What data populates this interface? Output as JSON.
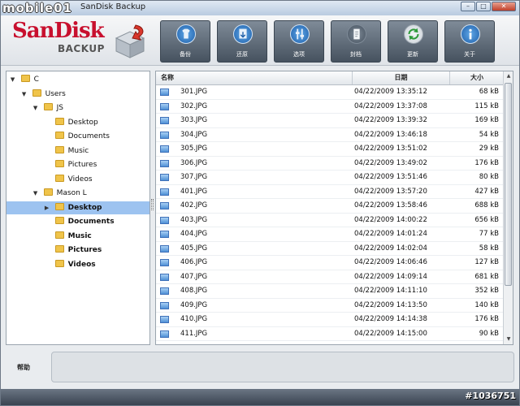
{
  "window": {
    "title": "SanDisk Backup",
    "watermark_logo": "mobile01",
    "watermark_id": "#1036751"
  },
  "brand": {
    "name": "SanDisk",
    "sub": "BACKUP",
    "color": "#c8102e"
  },
  "toolbar": [
    {
      "label": "备份",
      "icon": "shirt-icon"
    },
    {
      "label": "还原",
      "icon": "restore-icon"
    },
    {
      "label": "选项",
      "icon": "options-icon"
    },
    {
      "label": "封档",
      "icon": "archive-icon"
    },
    {
      "label": "更新",
      "icon": "refresh-icon"
    },
    {
      "label": "关于",
      "icon": "info-icon"
    }
  ],
  "tree": [
    {
      "label": "C",
      "toggle": "▼",
      "bold": false,
      "selected": false
    },
    {
      "label": "Users",
      "toggle": "▼",
      "bold": false,
      "selected": false
    },
    {
      "label": "JS",
      "toggle": "▼",
      "bold": false,
      "selected": false
    },
    {
      "label": "Desktop",
      "toggle": "",
      "bold": false,
      "selected": false
    },
    {
      "label": "Documents",
      "toggle": "",
      "bold": false,
      "selected": false
    },
    {
      "label": "Music",
      "toggle": "",
      "bold": false,
      "selected": false
    },
    {
      "label": "Pictures",
      "toggle": "",
      "bold": false,
      "selected": false
    },
    {
      "label": "Videos",
      "toggle": "",
      "bold": false,
      "selected": false
    },
    {
      "label": "Mason L",
      "toggle": "▼",
      "bold": false,
      "selected": false
    },
    {
      "label": "Desktop",
      "toggle": "▶",
      "bold": true,
      "selected": true
    },
    {
      "label": "Documents",
      "toggle": "",
      "bold": true,
      "selected": false
    },
    {
      "label": "Music",
      "toggle": "",
      "bold": true,
      "selected": false
    },
    {
      "label": "Pictures",
      "toggle": "",
      "bold": true,
      "selected": false
    },
    {
      "label": "Videos",
      "toggle": "",
      "bold": true,
      "selected": false
    }
  ],
  "grid": {
    "headers": {
      "name": "名称",
      "date": "日期",
      "size": "大小"
    },
    "rows": [
      {
        "name": "301.JPG",
        "date": "04/22/2009 13:35:12",
        "size": "68 kB"
      },
      {
        "name": "302.JPG",
        "date": "04/22/2009 13:37:08",
        "size": "115 kB"
      },
      {
        "name": "303.JPG",
        "date": "04/22/2009 13:39:32",
        "size": "169 kB"
      },
      {
        "name": "304.JPG",
        "date": "04/22/2009 13:46:18",
        "size": "54 kB"
      },
      {
        "name": "305.JPG",
        "date": "04/22/2009 13:51:02",
        "size": "29 kB"
      },
      {
        "name": "306.JPG",
        "date": "04/22/2009 13:49:02",
        "size": "176 kB"
      },
      {
        "name": "307.JPG",
        "date": "04/22/2009 13:51:46",
        "size": "80 kB"
      },
      {
        "name": "401.JPG",
        "date": "04/22/2009 13:57:20",
        "size": "427 kB"
      },
      {
        "name": "402.JPG",
        "date": "04/22/2009 13:58:46",
        "size": "688 kB"
      },
      {
        "name": "403.JPG",
        "date": "04/22/2009 14:00:22",
        "size": "656 kB"
      },
      {
        "name": "404.JPG",
        "date": "04/22/2009 14:01:24",
        "size": "77 kB"
      },
      {
        "name": "405.JPG",
        "date": "04/22/2009 14:02:04",
        "size": "58 kB"
      },
      {
        "name": "406.JPG",
        "date": "04/22/2009 14:06:46",
        "size": "127 kB"
      },
      {
        "name": "407.JPG",
        "date": "04/22/2009 14:09:14",
        "size": "681 kB"
      },
      {
        "name": "408.JPG",
        "date": "04/22/2009 14:11:10",
        "size": "352 kB"
      },
      {
        "name": "409.JPG",
        "date": "04/22/2009 14:13:50",
        "size": "140 kB"
      },
      {
        "name": "410.JPG",
        "date": "04/22/2009 14:14:38",
        "size": "176 kB"
      },
      {
        "name": "411.JPG",
        "date": "04/22/2009 14:15:00",
        "size": "90 kB"
      }
    ]
  },
  "help": {
    "label": "帮助",
    "text": ""
  }
}
